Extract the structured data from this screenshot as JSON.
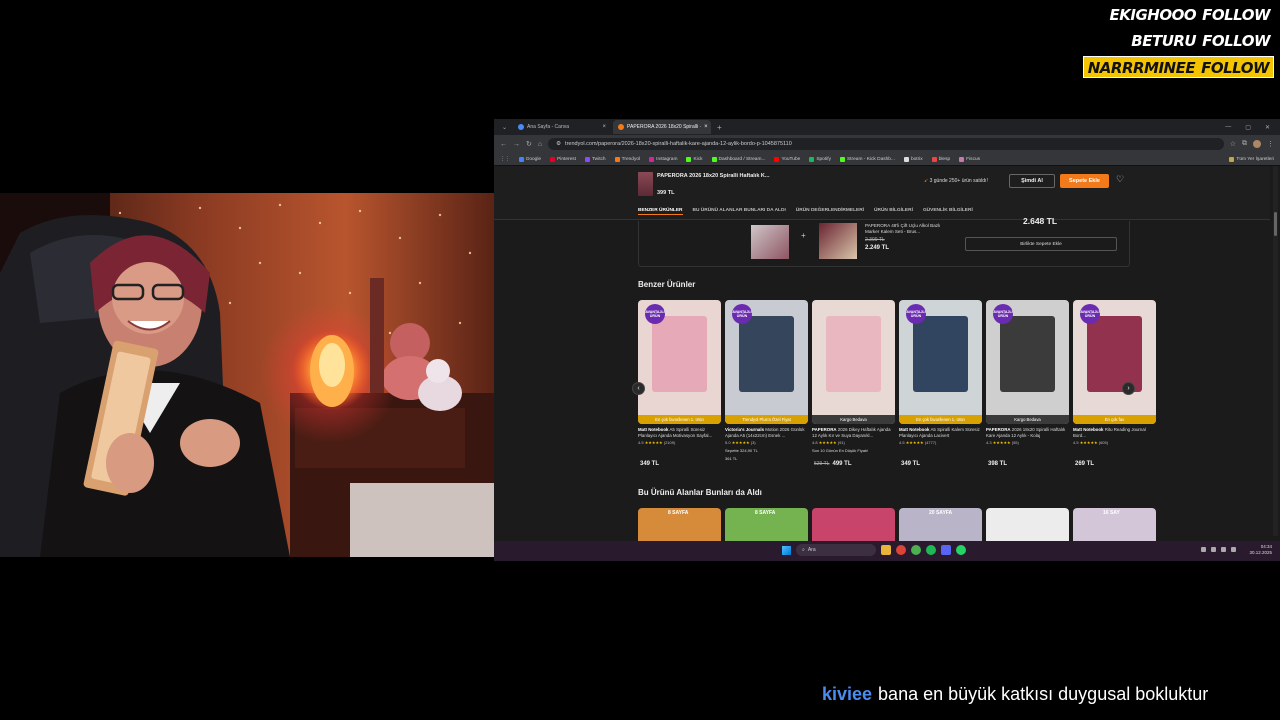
{
  "follows": [
    {
      "name": "EKIGHOOO",
      "word": "FOLLOW",
      "highlight": false
    },
    {
      "name": "BETURU",
      "word": "FOLLOW",
      "highlight": false
    },
    {
      "name": "NARRRMINEE",
      "word": "FOLLOW",
      "highlight": true
    }
  ],
  "browser": {
    "tabs": [
      {
        "label": "Ana Sayfa - Canva",
        "active": false
      },
      {
        "label": "PAPERORA 2026 18x20 Spiralli ·",
        "active": true
      }
    ],
    "url": "trendyol.com/paperora/2026-18x20-spiralli-haftalik-kare-ajanda-12-aylik-bordo-p-1045875110",
    "bookmarks": [
      "Google",
      "Pinterest",
      "Twitch",
      "Trendyol",
      "Instagram",
      "Kick",
      "Dashboard / Stream...",
      "YouTube",
      "Spotify",
      "Stream - Kick Dashb...",
      "botrix",
      "blesp",
      "Fiscus"
    ],
    "bookmarks_right": "Tüm Yer İşaretleri"
  },
  "product_bar": {
    "name": "PAPERORA 2026 18x20 Spiralli Haftalık K...",
    "price": "399 TL",
    "sold_text": "3 günde 250+ ürün satıldı!",
    "buy_now": "Şimdi Al",
    "add_to_cart": "Sepete Ekle",
    "tabs": [
      "BENZER ÜRÜNLER",
      "BU ÜRÜNÜ ALANLAR BUNLARI DA ALDI",
      "ÜRÜN DEĞERLENDİRMELERİ",
      "ÜRÜN BİLGİLERİ",
      "GÜVENLİK BİLGİLERİ"
    ]
  },
  "combo": {
    "item_name": "PAPERORA 48'li Çift Uçlu Alkol Bazlı Marker Kalem Seti - Brus...",
    "old_price": "2.399 TL",
    "new_price": "2.249 TL",
    "total": "2.648 TL",
    "button": "Birlikte Sepete Ekle"
  },
  "similar": {
    "title": "Benzer Ürünler",
    "items": [
      {
        "brand": "Matt Notebook",
        "name": "A5 Spiralli Süresiz Planlayıcı Ajanda Motivasyon Sayfal...",
        "rating": "4.5",
        "reviews": "(2109)",
        "strip": "En çok favorilenen 1. ürün",
        "strip_color": "#d9a100",
        "badge": "AVANTAJLI ÜRÜN",
        "extra": "",
        "old_price": "",
        "price": "349 TL",
        "img_bg": "#e9d6d2",
        "deco": "#e6a4b4"
      },
      {
        "brand": "Victoria's Journals",
        "name": "Motion 2026 Günlük Ajanda A5 (14x22cm) Esnek ...",
        "rating": "5.0",
        "reviews": "(3)",
        "strip": "Trendyol Plus'a Özel Fiyat",
        "strip_color": "#d9a100",
        "badge": "AVANTAJLI ÜRÜN",
        "extra": "Sepette 324,90 TL",
        "sub_extra": "361 TL",
        "old_price": "",
        "price": "",
        "img_bg": "#c9cbd3",
        "deco": "#23364f"
      },
      {
        "brand": "PAPERORA",
        "name": "2026 Dikey Haftalık Ajanda 12 Aylık Kır ve Suya Dayanıkl...",
        "rating": "4.8",
        "reviews": "(91)",
        "strip": "Kargo Bedava",
        "strip_color": "#3a3a3a",
        "badge": "",
        "extra": "Son 10 Günün En Düşük Fiyatı!",
        "old_price": "529 TL",
        "price": "499 TL",
        "img_bg": "#e8d9d4",
        "deco": "#e8b3bd"
      },
      {
        "brand": "Matt Notebook",
        "name": "A5 Spiralli Kalem Süresiz Planlayıcı Ajanda Lacivert",
        "rating": "4.5",
        "reviews": "(4777)",
        "strip": "En çok favorilenen 1. ürün",
        "strip_color": "#d9a100",
        "badge": "AVANTAJLI ÜRÜN",
        "extra": "",
        "old_price": "",
        "price": "349 TL",
        "img_bg": "#cfd5d6",
        "deco": "#1f3553"
      },
      {
        "brand": "PAPERORA",
        "name": "2026 18x20 Spiralli Haftalık Kare Ajanda 12 Aylık - Kolaj",
        "rating": "4.3",
        "reviews": "(55)",
        "strip": "Kargo Bedava",
        "strip_color": "#3a3a3a",
        "badge": "AVANTAJLI ÜRÜN",
        "extra": "",
        "old_price": "",
        "price": "398 TL",
        "img_bg": "#cfcfcf",
        "deco": "#2a2a2a"
      },
      {
        "brand": "Matt Notebook",
        "name": "Ritu Reading Journal Bord...",
        "rating": "4.5",
        "reviews": "(605)",
        "strip": "En çok fav",
        "strip_color": "#d9a100",
        "badge": "AVANTAJLI ÜRÜN",
        "extra": "",
        "old_price": "",
        "price": "269 TL",
        "img_bg": "#e6d9d6",
        "deco": "#8a1f3f"
      }
    ]
  },
  "also_bought": {
    "title": "Bu Ürünü Alanlar Bunları da Aldı",
    "items": [
      {
        "tag": "8 SAYFA",
        "bg": "#d68b3a"
      },
      {
        "tag": "8 SAYFA",
        "bg": "#74b350"
      },
      {
        "tag": "",
        "bg": "#c8446a"
      },
      {
        "tag": "20 SAYFA",
        "bg": "#b9b4c8"
      },
      {
        "tag": "",
        "bg": "#ececec"
      },
      {
        "tag": "16 SAY",
        "bg": "#d4c6d9"
      }
    ]
  },
  "taskbar": {
    "search": "Ara",
    "time": "04:34",
    "date": "30.12.2025"
  },
  "chat": {
    "user": "kiviee",
    "message": "bana en büyük katkısı duygusal bokluktur"
  },
  "colors": {
    "accent": "#f27a1a",
    "follow_highlight": "#f5c400",
    "chat_user": "#4a8cf0"
  }
}
